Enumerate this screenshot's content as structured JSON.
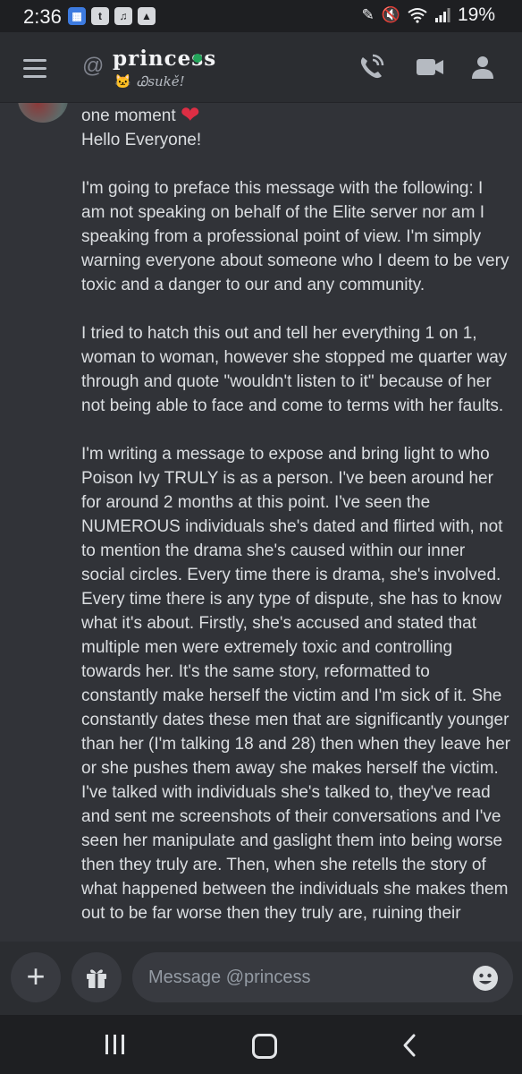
{
  "statusbar": {
    "time": "2:36",
    "battery": "19%",
    "icons": [
      "calendar-icon",
      "twitch-icon",
      "music-icon",
      "image-icon",
      "pen-icon",
      "mute-icon",
      "wifi-icon",
      "signal-icon"
    ]
  },
  "header": {
    "at_symbol": "@",
    "username": "princess",
    "status_emoji": "🐱",
    "status_text": "Ꮚsukě!",
    "online_color": "#23a55a"
  },
  "messages": [
    {
      "paragraphs": [
        "one moment",
        "Hello Everyone!",
        "I'm going to preface this message with the following: I am not speaking on behalf of the Elite server nor am I speaking from a professional point of view. I'm simply warning everyone about someone who I deem to be very toxic and a danger to our and any community.",
        "I tried to hatch this out and tell her everything 1 on 1, woman to woman, however she stopped me quarter way through and quote \"wouldn't listen to it\" because of her not being able to face and come to terms with her faults.",
        "I'm writing a message to expose and bring light to who Poison Ivy TRULY is as a person. I've been around her for around 2 months at this point. I've seen the NUMEROUS individuals she's dated and flirted with, not to mention the drama she's caused within our inner social circles. Every time there is drama, she's involved. Every time there is any type of dispute, she has to know what it's about. Firstly, she's accused and stated that multiple men were extremely toxic and controlling towards her. It's the same story, reformatted to constantly make herself the victim and I'm sick of it. She constantly dates these men that are significantly younger than her (I'm talking 18 and 28) then when they leave her or she pushes them away she makes herself the victim. I've talked with individuals she's talked to, they've read and sent me screenshots of their conversations and I've seen her manipulate and gaslight them into being worse then they truly are. Then, when she retells the story of what happened between the individuals she makes them out to be far worse then they truly are, ruining their"
      ],
      "heart_emoji": "❤"
    }
  ],
  "composer": {
    "placeholder": "Message @princess",
    "plus_label": "+"
  },
  "colors": {
    "background": "#313338",
    "header": "#2b2d31",
    "status_bar": "#1e1f22",
    "input": "#383a40"
  }
}
